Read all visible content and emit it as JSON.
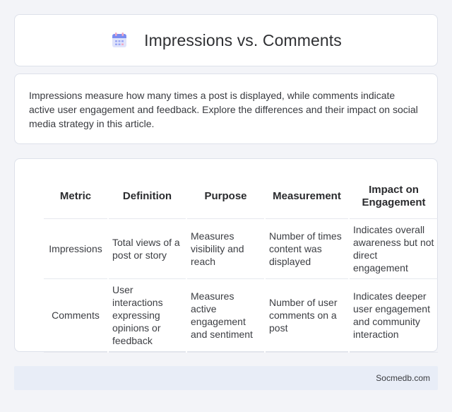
{
  "header": {
    "title": "Impressions vs. Comments",
    "icon": "calendar-icon"
  },
  "intro": {
    "text": "Impressions measure how many times a post is displayed, while comments indicate active user engagement and feedback. Explore the differences and their impact on social media strategy in this article."
  },
  "table": {
    "headers": [
      "Metric",
      "Definition",
      "Purpose",
      "Measurement",
      "Impact on Engagement"
    ],
    "rows": [
      [
        "Impressions",
        "Total views of a post or story",
        "Measures visibility and reach",
        "Number of times content was displayed",
        "Indicates overall awareness but not direct engagement"
      ],
      [
        "Comments",
        "User interactions expressing opinions or feedback",
        "Measures active engagement and sentiment",
        "Number of user comments on a post",
        "Indicates deeper user engagement and community interaction"
      ]
    ]
  },
  "footer": {
    "text": "Socmedb.com"
  },
  "colors": {
    "background": "#f3f4f8",
    "card": "#ffffff",
    "footer_bar": "#e8edf7",
    "icon_accent": "#7b8cf0"
  }
}
